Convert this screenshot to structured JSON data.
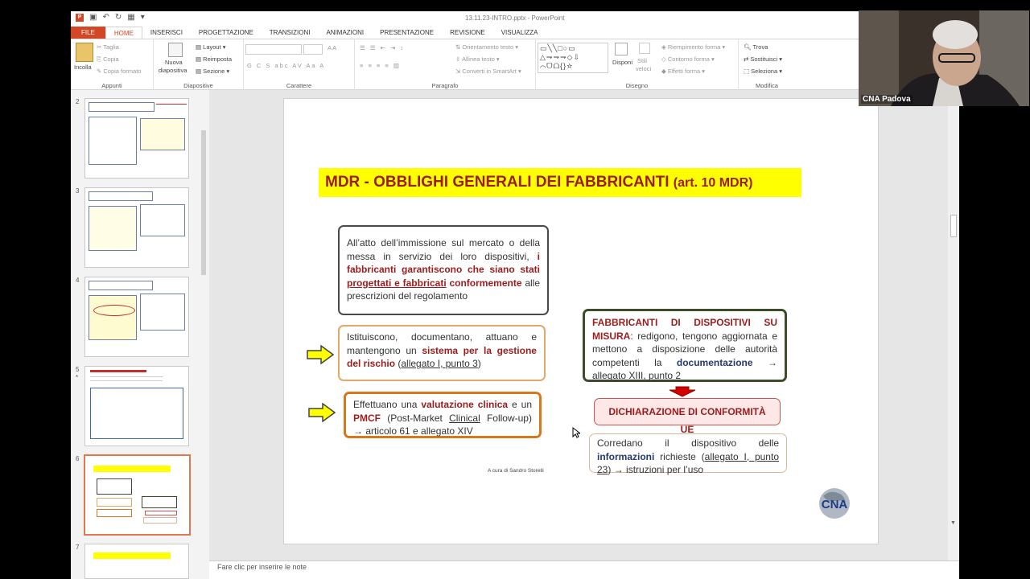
{
  "window": {
    "title": "13.11.23-INTRO.pptx - PowerPoint"
  },
  "tabs": [
    "FILE",
    "HOME",
    "INSERISCI",
    "PROGETTAZIONE",
    "TRANSIZIONI",
    "ANIMAZIONI",
    "PRESENTAZIONE",
    "REVISIONE",
    "VISUALIZZA"
  ],
  "ribbon": {
    "appunti": {
      "incolla": "Incolla",
      "taglia": "Taglia",
      "copia": "Copia",
      "copia_formato": "Copia formato",
      "label": "Appunti"
    },
    "diapositive": {
      "nuova": "Nuova",
      "diapositiva": "diapositiva",
      "layout": "Layout",
      "reimposta": "Reimposta",
      "sezione": "Sezione",
      "label": "Diapositive"
    },
    "carattere": {
      "label": "Carattere",
      "letters": "G  C  S  abc  AV  Aa  A"
    },
    "paragrafo": {
      "orientamento": "Orientamento testo",
      "allinea": "Allinea testo",
      "converti": "Converti in SmartArt",
      "label": "Paragrafo"
    },
    "disegno": {
      "disponi": "Disponi",
      "stili": "Stili",
      "veloci": "veloci",
      "riempimento": "Riempimento forma",
      "contorno": "Contorno forma",
      "effetti": "Effetti forma",
      "label": "Disegno"
    },
    "modifica": {
      "trova": "Trova",
      "sostituisci": "Sostituisci",
      "seleziona": "Seleziona",
      "label": "Modifica"
    }
  },
  "thumbnails": [
    {
      "num": "2",
      "star": ""
    },
    {
      "num": "3",
      "star": ""
    },
    {
      "num": "4",
      "star": ""
    },
    {
      "num": "5",
      "star": "*"
    },
    {
      "num": "6",
      "star": ""
    },
    {
      "num": "7",
      "star": ""
    }
  ],
  "slide": {
    "title_main": "MDR - OBBLIGHI GENERALI DEI FABBRICANTI",
    "title_ref": "(art. 10 MDR)",
    "box1": {
      "p1": "All’atto dell’immissione sul mercato o della messa in servizio dei loro dispositivi, ",
      "bold1": "i fabbricanti garantiscono che siano stati ",
      "bold_u": "progettati e fabbricati",
      "bold2": " conformemente",
      "p2": " alle prescrizioni del regolamento"
    },
    "box2": {
      "p1": "Istituiscono, documentano, attuano e mantengono un ",
      "bold": "sistema per la gestione del rischio",
      "p2": " (",
      "link": "allegato I, punto 3",
      "p3": ")"
    },
    "box3": {
      "p1": "Effettuano una ",
      "bold1": "valutazione clinica",
      "p2": " e un ",
      "bold2": "PMCF",
      "p3": " (Post-Market ",
      "u": "Clinical",
      "p4": " Follow-up) → articolo 61 e allegato XIV"
    },
    "box4": {
      "bold": "FABBRICANTI DI DISPOSITIVI SU MISURA",
      "p1": ": redigono, tengono aggiornata e mettono a disposizione delle autorità competenti la ",
      "bold2": "documentazione",
      "p2": " → ",
      "link": "allegato XIII, punto 2"
    },
    "box5": "DICHIARAZIONE DI CONFORMITÀ UE",
    "box6": {
      "p1": "Corredano il dispositivo delle ",
      "bold": "informazioni",
      "p2": " richieste (",
      "link": "allegato I, punto 23",
      "p3": ") → istruzioni per l’uso"
    },
    "signature": "A cura di Sandro Storelli",
    "logo": "CNA"
  },
  "notes": {
    "placeholder": "Fare clic per inserire le note"
  },
  "webcam": {
    "label": "CNA Padova"
  }
}
